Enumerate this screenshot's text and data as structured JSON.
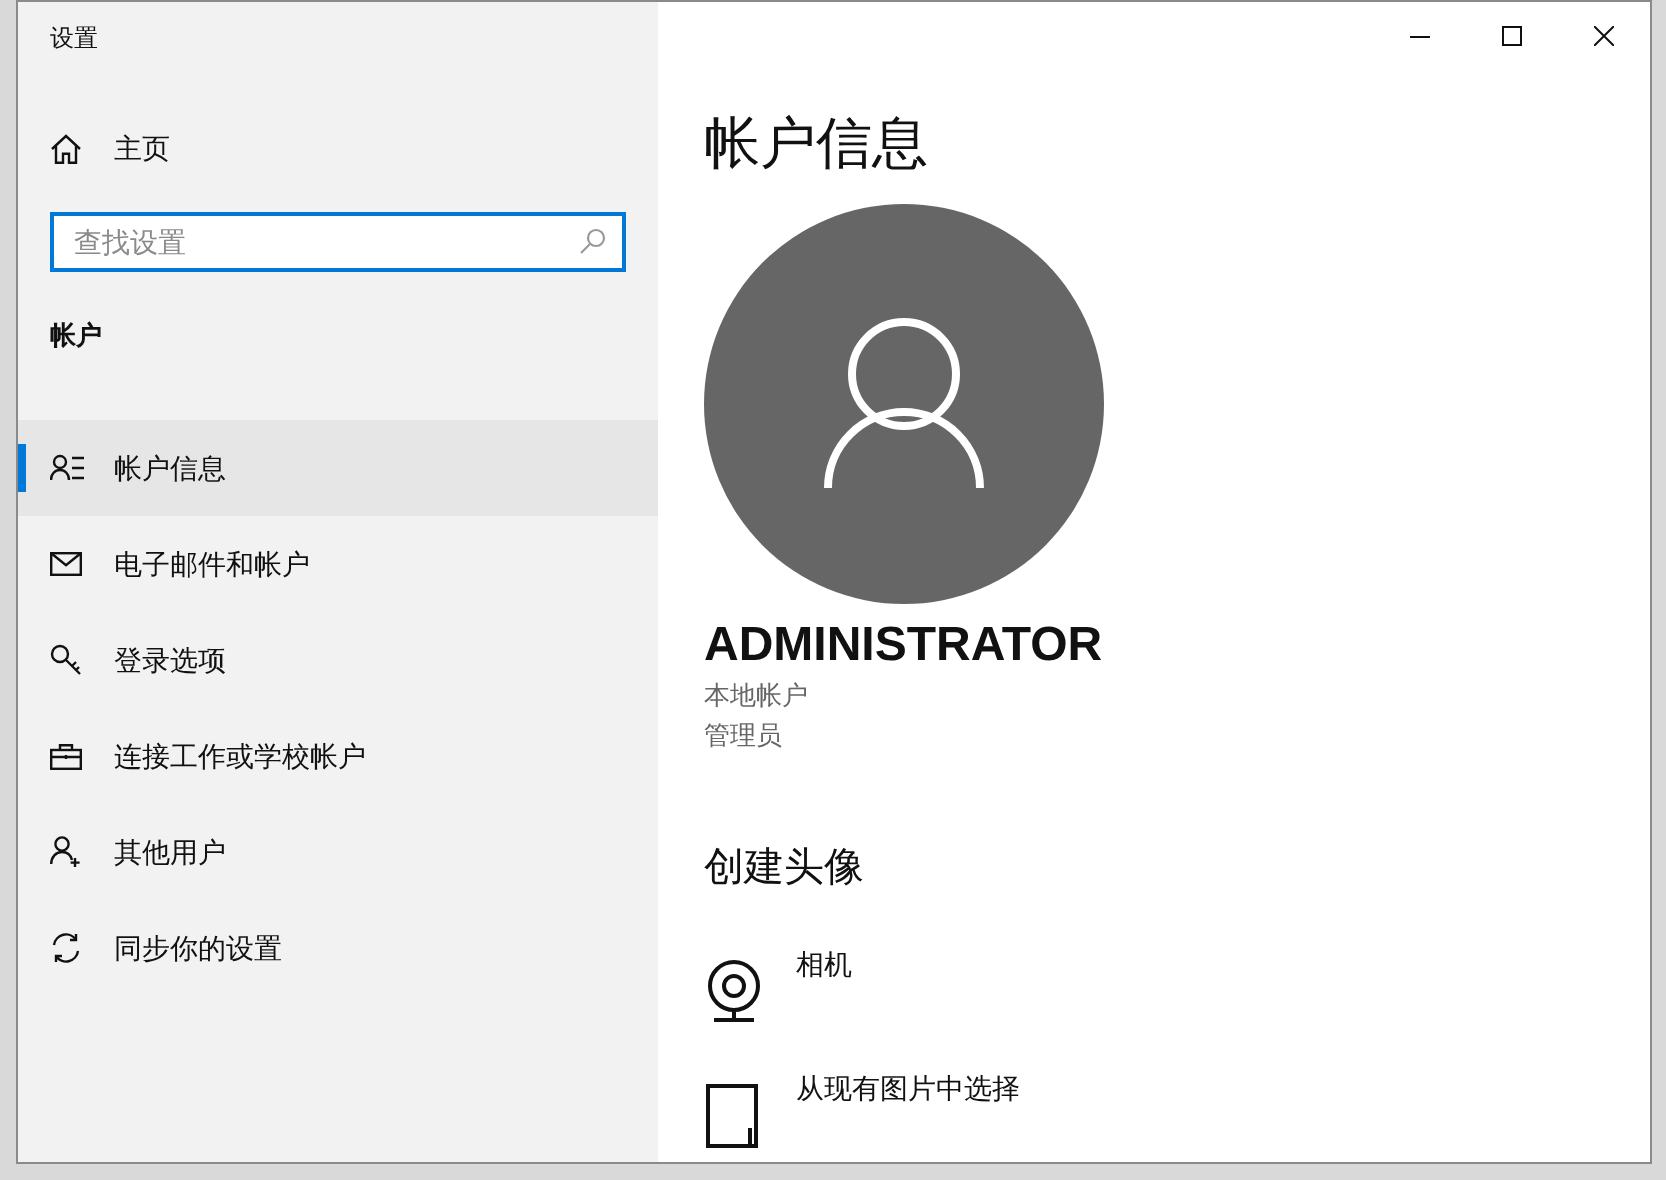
{
  "window": {
    "title": "设置"
  },
  "sidebar": {
    "home": "主页",
    "search": {
      "placeholder": "查找设置"
    },
    "section": "帐户",
    "items": [
      {
        "label": "帐户信息",
        "selected": true
      },
      {
        "label": "电子邮件和帐户",
        "selected": false
      },
      {
        "label": "登录选项",
        "selected": false
      },
      {
        "label": "连接工作或学校帐户",
        "selected": false
      },
      {
        "label": "其他用户",
        "selected": false
      },
      {
        "label": "同步你的设置",
        "selected": false
      }
    ]
  },
  "content": {
    "title": "帐户信息",
    "user": {
      "name": "ADMINISTRATOR",
      "account_type": "本地帐户",
      "role": "管理员"
    },
    "create_avatar": {
      "heading": "创建头像",
      "options": [
        "相机",
        "从现有图片中选择"
      ]
    }
  }
}
